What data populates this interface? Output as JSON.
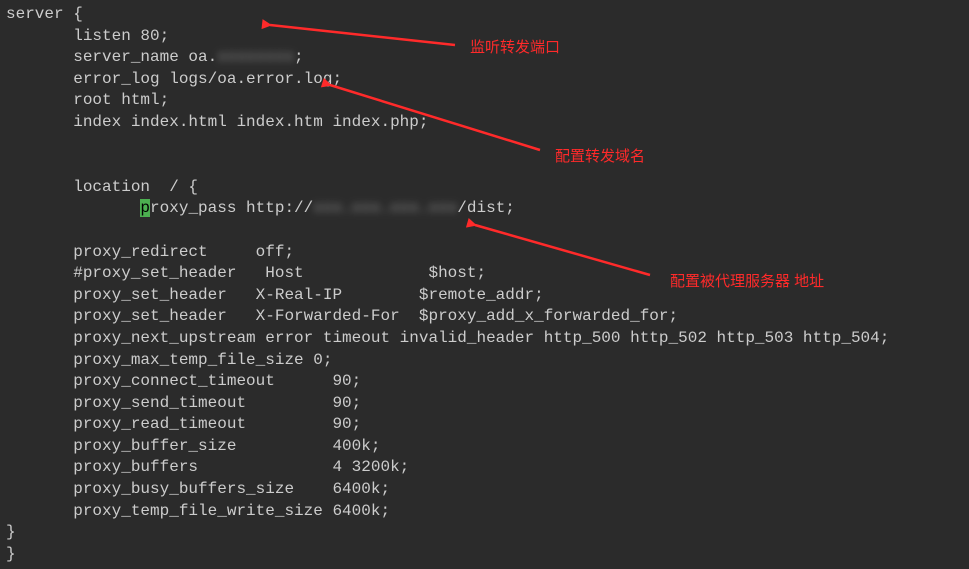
{
  "code": {
    "l0": "server {",
    "l1": "       listen 80;",
    "l2_a": "       server_name oa.",
    "l2_b": "xxxxxxxx",
    "l2_c": ";",
    "l3": "       error_log logs/oa.error.log;",
    "l4": "       root html;",
    "l5": "       index index.html index.htm index.php;",
    "l6": "",
    "l7": "",
    "l8": "       location  / {",
    "l9_a": "              ",
    "l9_cursor": "p",
    "l9_b": "roxy_pass http://",
    "l9_c": "xxx.xxx.xxx.xxx",
    "l9_d": "/dist;",
    "l10": "",
    "l11": "       proxy_redirect     off;",
    "l12": "       #proxy_set_header   Host             $host;",
    "l13": "       proxy_set_header   X-Real-IP        $remote_addr;",
    "l14": "       proxy_set_header   X-Forwarded-For  $proxy_add_x_forwarded_for;",
    "l15": "       proxy_next_upstream error timeout invalid_header http_500 http_502 http_503 http_504;",
    "l16": "       proxy_max_temp_file_size 0;",
    "l17": "       proxy_connect_timeout      90;",
    "l18": "       proxy_send_timeout         90;",
    "l19": "       proxy_read_timeout         90;",
    "l20": "       proxy_buffer_size          400k;",
    "l21": "       proxy_buffers              4 3200k;",
    "l22": "       proxy_busy_buffers_size    6400k;",
    "l23": "       proxy_temp_file_write_size 6400k;",
    "l24": "}",
    "l25": "}"
  },
  "annotations": {
    "a1": "监听转发端口",
    "a2": "配置转发域名",
    "a3": "配置被代理服务器 地址"
  }
}
